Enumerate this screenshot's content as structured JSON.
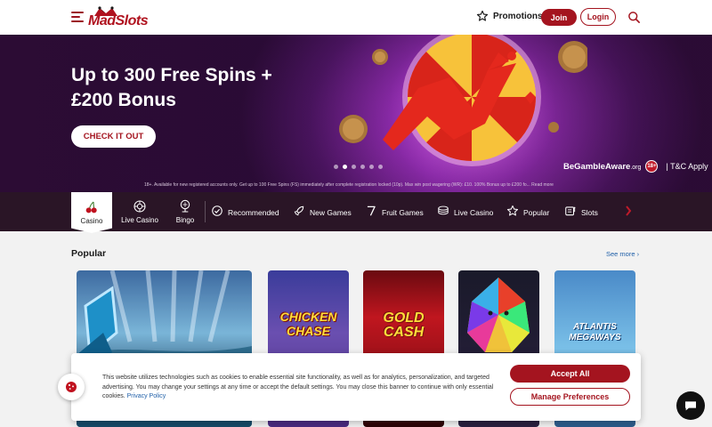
{
  "brand": {
    "logo_text": "MadSlots",
    "accent": "#a4141f"
  },
  "header": {
    "promotions_label": "Promotions",
    "join_label": "Join",
    "login_label": "Login"
  },
  "hero": {
    "title_line1": "Up to 300 Free Spins +",
    "title_line2": "£200 Bonus",
    "cta_label": "CHECK IT OUT",
    "gamble_aware": "BeGambleAware",
    "gamble_aware_suffix": ".org",
    "age_badge": "18+",
    "tc_label": "| T&C Apply",
    "disclaimer": "18+. Available for new registered accounts only. Get up to 100 Free Spins (FS) immediately after complete registration locked (10p). Max win post wagering (WR): £10. 100% Bonus up to £200 fo... Read more",
    "slides": 6,
    "active_slide": 2
  },
  "categories": {
    "tabs": [
      {
        "label": "Casino",
        "icon": "cherries-icon",
        "active": true
      },
      {
        "label": "Live Casino",
        "icon": "roulette-icon",
        "active": false
      },
      {
        "label": "Bingo",
        "icon": "bingo-icon",
        "active": false
      }
    ],
    "chips": [
      {
        "label": "Recommended",
        "icon": "check-circle-icon"
      },
      {
        "label": "New Games",
        "icon": "rocket-icon"
      },
      {
        "label": "Fruit Games",
        "icon": "seven-icon"
      },
      {
        "label": "Live Casino",
        "icon": "chips-icon"
      },
      {
        "label": "Popular",
        "icon": "star-icon"
      },
      {
        "label": "Slots",
        "icon": "slot-machine-icon"
      }
    ]
  },
  "popular": {
    "title": "Popular",
    "see_more": "See more",
    "games": [
      {
        "name": ""
      },
      {
        "name": "CHICKEN CHASE"
      },
      {
        "name": "GOLD CASH"
      },
      {
        "name": ""
      },
      {
        "name": "ATLANTIS MEGAWAYS"
      }
    ]
  },
  "cookie": {
    "text": "This website utilizes technologies such as cookies to enable essential site functionality, as well as for analytics, personalization, and targeted advertising. You may change your settings at any time or accept the default settings. You may close this banner to continue with only essential cookies.",
    "policy_link": "Privacy Policy",
    "accept_label": "Accept All",
    "manage_label": "Manage Preferences"
  }
}
